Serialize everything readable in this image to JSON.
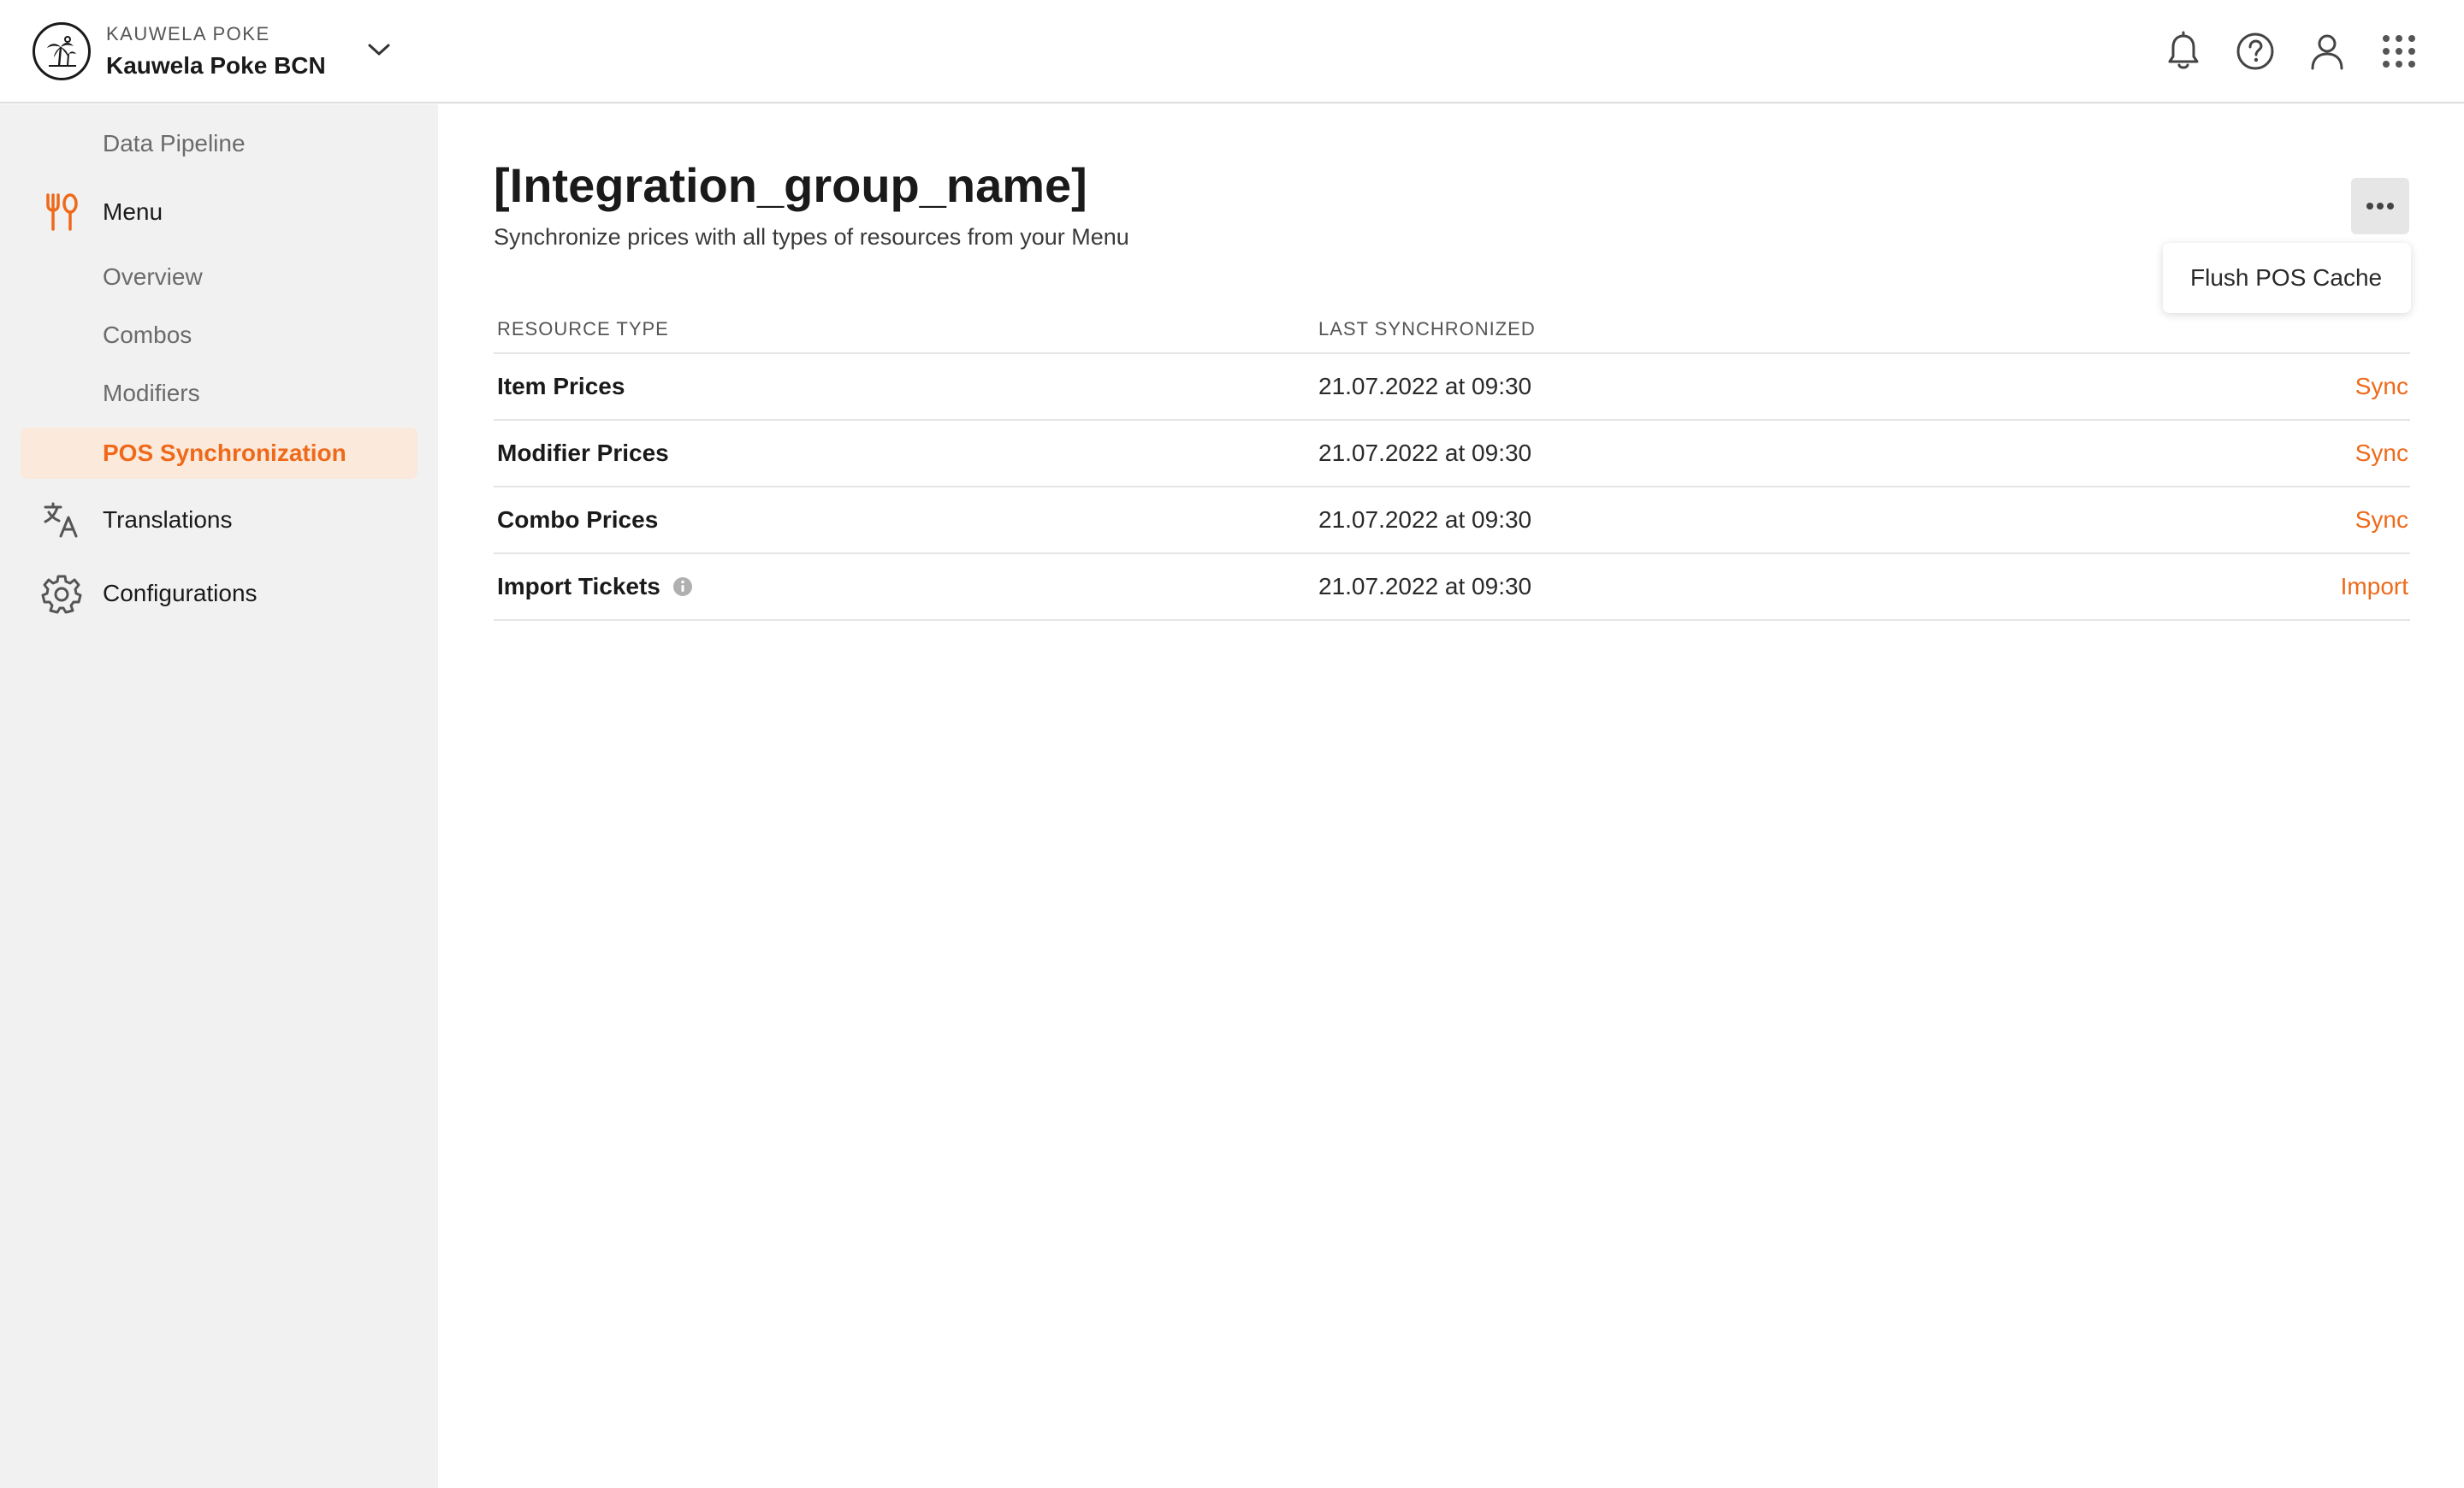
{
  "header": {
    "org_kicker": "KAUWELA POKE",
    "org_name": "Kauwela Poke BCN",
    "icons": [
      "bell-icon",
      "help-circle-icon",
      "user-icon",
      "apps-grid-icon"
    ]
  },
  "sidebar": {
    "top_item": "Data Pipeline",
    "menu_label": "Menu",
    "menu_children": [
      "Overview",
      "Combos",
      "Modifiers"
    ],
    "active_item": "POS Synchronization",
    "translations_label": "Translations",
    "configurations_label": "Configurations"
  },
  "main": {
    "title": "[Integration_group_name]",
    "subtitle": "Synchronize prices with all types of resources from your Menu",
    "dropdown_item": "Flush POS Cache",
    "table": {
      "columns": [
        "RESOURCE TYPE",
        "LAST SYNCHRONIZED"
      ],
      "rows": [
        {
          "name": "Item Prices",
          "date": "21.07.2022 at 09:30",
          "action": "Sync"
        },
        {
          "name": "Modifier Prices",
          "date": "21.07.2022 at 09:30",
          "action": "Sync"
        },
        {
          "name": "Combo Prices",
          "date": "21.07.2022 at 09:30",
          "action": "Sync"
        },
        {
          "name": "Import Tickets",
          "date": "21.07.2022 at 09:30",
          "action": "Import"
        }
      ]
    }
  },
  "colors": {
    "accent": "#ee6a1a",
    "active_bg": "#fbe9dc",
    "sidebar_bg": "#f1f1f1"
  }
}
